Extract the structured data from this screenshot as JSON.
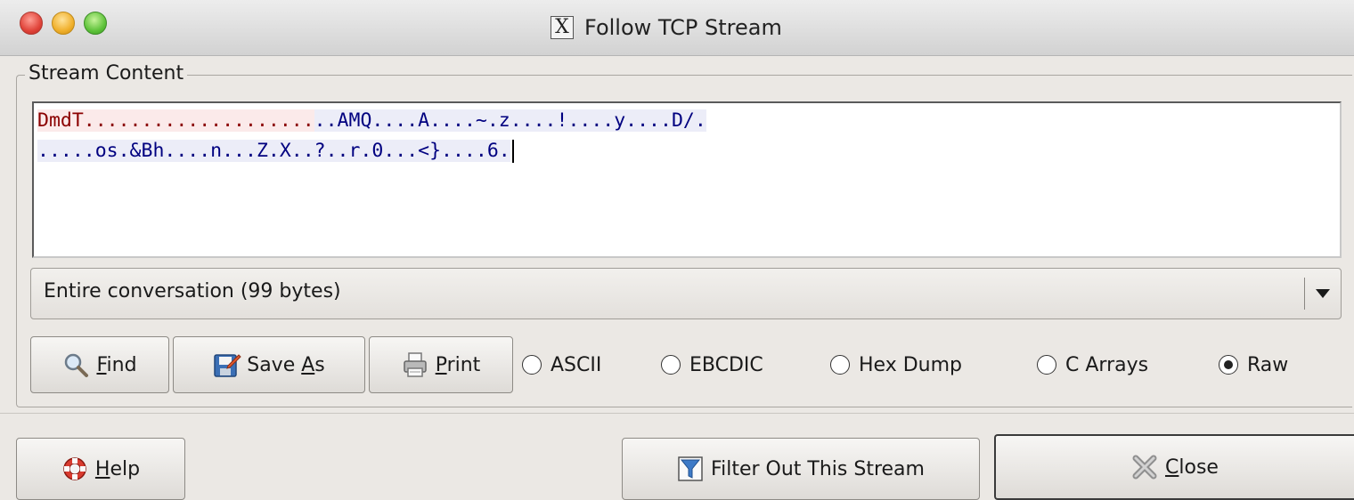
{
  "window": {
    "title": "Follow TCP Stream",
    "x_icon": "X"
  },
  "stream_content": {
    "label": "Stream Content",
    "line1_client": "DmdT....................",
    "line1_server": "..AMQ....A....~.z....!....y....D/.",
    "line2_server": ".....os.&Bh....n...Z.X..?..r.0...<}....6."
  },
  "conversation_select": {
    "value": "Entire conversation (99 bytes)"
  },
  "toolbar": {
    "find_pre": "",
    "find_key": "F",
    "find_post": "ind",
    "saveas_pre": "Save ",
    "saveas_key": "A",
    "saveas_post": "s",
    "print_pre": "",
    "print_key": "P",
    "print_post": "rint"
  },
  "format_radios": [
    {
      "label": "ASCII",
      "selected": false
    },
    {
      "label": "EBCDIC",
      "selected": false
    },
    {
      "label": "Hex Dump",
      "selected": false
    },
    {
      "label": "C Arrays",
      "selected": false
    },
    {
      "label": "Raw",
      "selected": true
    }
  ],
  "bottom": {
    "help_pre": "",
    "help_key": "H",
    "help_post": "elp",
    "filter_label": "Filter Out This Stream",
    "close_pre": "",
    "close_key": "C",
    "close_post": "lose"
  },
  "colors": {
    "client_bg": "#fbeaea",
    "client_fg": "#8b0000",
    "server_bg": "#ecedf8",
    "server_fg": "#000080"
  }
}
